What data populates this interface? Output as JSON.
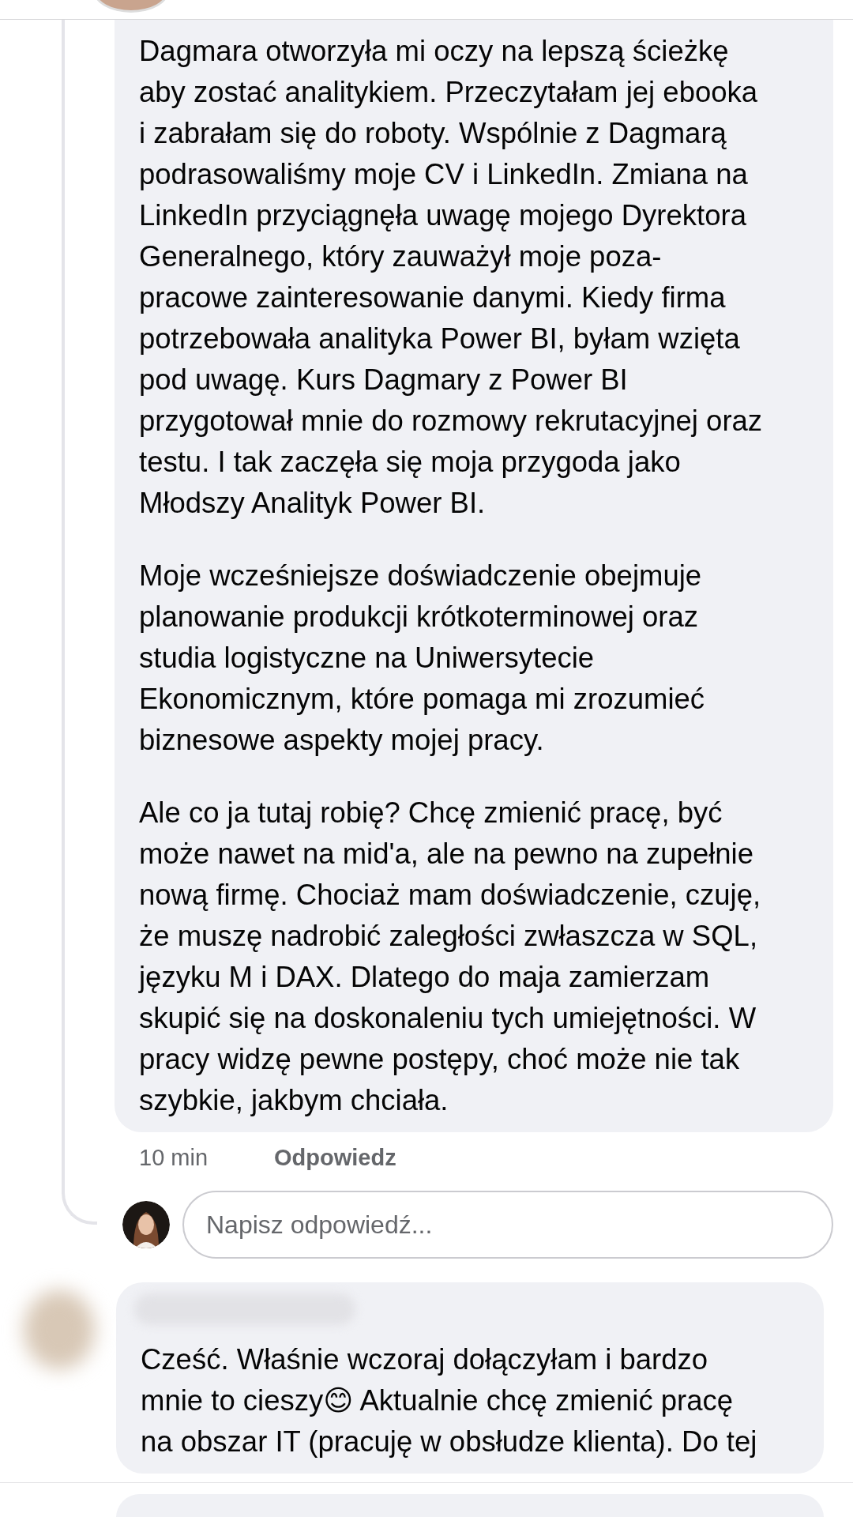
{
  "comments": [
    {
      "kind": "reply",
      "paragraphs": [
        "Dagmara otworzyła mi oczy na lepszą ścieżkę\naby zostać analitykiem. Przeczytałam jej ebooka\ni zabrałam się do roboty. Wspólnie z Dagmarą\npodrasowaliśmy moje CV i LinkedIn. Zmiana na\nLinkedIn przyciągnęła uwagę mojego Dyrektora\nGeneralnego, który zauważył moje poza-\npracowe zainteresowanie danymi. Kiedy firma\npotrzebowała analityka Power BI, byłam wzięta\npod uwagę. Kurs Dagmary z Power BI\nprzygotował mnie do rozmowy rekrutacyjnej oraz\ntestu. I tak zaczęła się moja przygoda jako\nMłodszy Analityk Power BI.",
        "Moje wcześniejsze doświadczenie obejmuje\nplanowanie produkcji krótkoterminowej oraz\nstudia logistyczne na Uniwersytecie\nEkonomicznym, które pomaga mi zrozumieć\nbiznesowe aspekty mojej pracy.",
        "Ale co ja tutaj robię? Chcę zmienić pracę, być\nmoże nawet na mid'a, ale na pewno na zupełnie\nnową firmę. Chociaż mam doświadczenie, czuję,\nże muszę nadrobić zaległości zwłaszcza w SQL,\njęzyku M i DAX. Dlatego do maja zamierzam\nskupić się na doskonaleniu tych umiejętności. W\npracy widzę pewne postępy, choć może nie tak\nszybkie, jakbym chciała."
      ],
      "time": "10 min",
      "reply_action": "Odpowiedz",
      "reply_placeholder": "Napisz odpowiedź..."
    },
    {
      "kind": "comment",
      "paragraphs": [
        "Cześć. Właśnie wczoraj dołączyłam i bardzo\nmnie to cieszy😊 Aktualnie chcę zmienić pracę\nna obszar IT (pracuję w obsłudze klienta). Do tej"
      ]
    }
  ]
}
